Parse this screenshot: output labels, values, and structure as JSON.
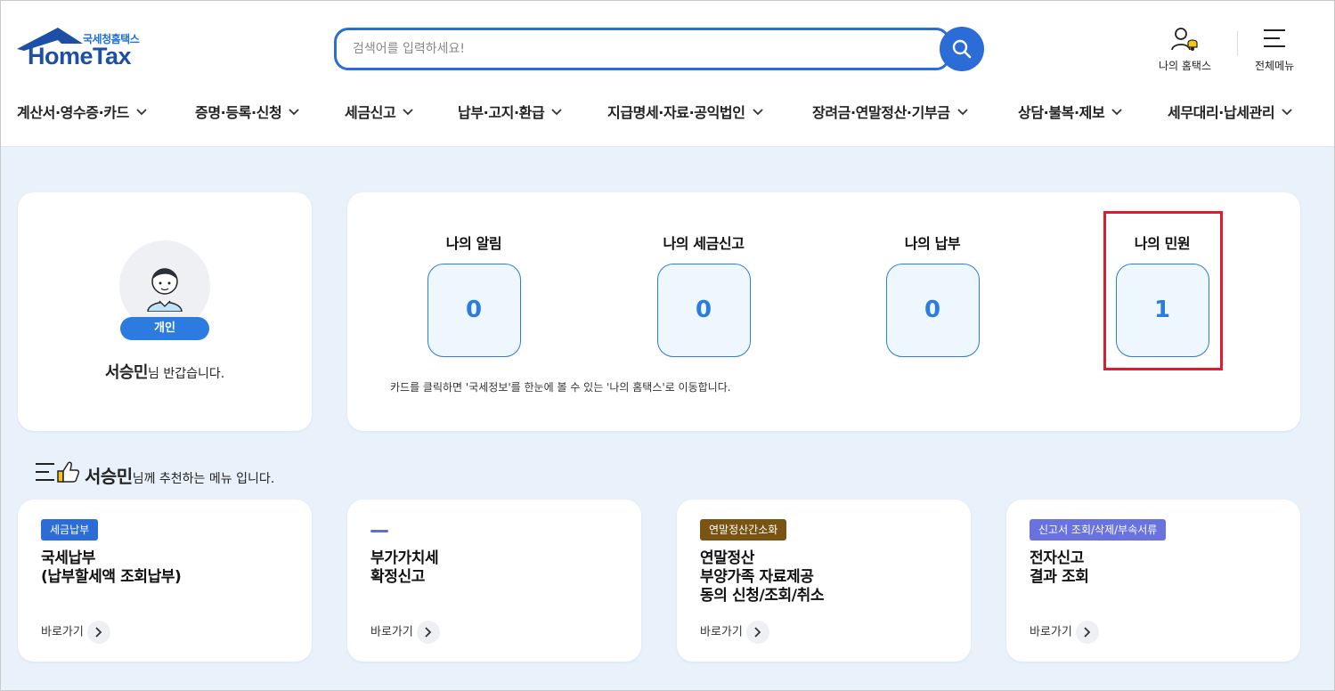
{
  "header": {
    "logo_sub": "국세청홈택스",
    "logo_main": "HomeTax",
    "search_placeholder": "검색어를 입력하세요!",
    "my_hometax_label": "나의 홈택스",
    "all_menu_label": "전체메뉴"
  },
  "nav": [
    "계산서·영수증·카드",
    "증명·등록·신청",
    "세금신고",
    "납부·고지·환급",
    "지급명세·자료·공익법인",
    "장려금·연말정산·기부금",
    "상담·불복·제보",
    "세무대리·납세관리"
  ],
  "profile": {
    "type_badge": "개인",
    "user_name": "서승민",
    "greeting_suffix": "님 반갑습니다."
  },
  "stats": [
    {
      "title": "나의 알림",
      "value": "0"
    },
    {
      "title": "나의 세금신고",
      "value": "0"
    },
    {
      "title": "나의 납부",
      "value": "0"
    },
    {
      "title": "나의 민원",
      "value": "1"
    }
  ],
  "stats_note": "카드를 클릭하면 '국세정보'를 한눈에 볼 수 있는 '나의 홈택스'로 이동합니다.",
  "recommend": {
    "user_name": "서승민",
    "suffix": "님께 추천하는 메뉴 입니다."
  },
  "menus": [
    {
      "tag": "세금납부",
      "tag_color": "#2b6cd6",
      "title": "국세납부\n(납부할세액 조회납부)",
      "link": "바로가기"
    },
    {
      "tag": "",
      "tag_color": "#5a6fd8",
      "title": "부가가치세\n확정신고",
      "link": "바로가기"
    },
    {
      "tag": "연말정산간소화",
      "tag_color": "#7a5412",
      "title": "연말정산\n부양가족 자료제공\n동의 신청/조회/취소",
      "link": "바로가기"
    },
    {
      "tag": "신고서 조회/삭제/부속서류",
      "tag_color": "#6a72e0",
      "title": "전자신고\n결과 조회",
      "link": "바로가기"
    }
  ],
  "colors": {
    "accent": "#2b6cd6",
    "background": "#e9f2fb",
    "highlight": "#e01b2d"
  }
}
